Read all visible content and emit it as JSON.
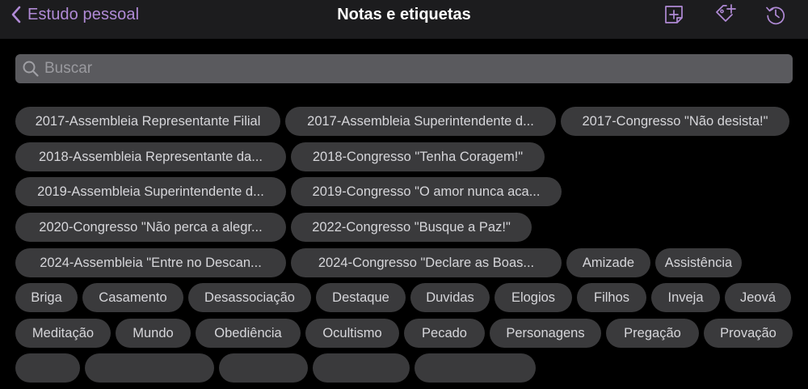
{
  "header": {
    "back_label": "Estudo pessoal",
    "title": "Notas e etiquetas",
    "actions": [
      "add-note-icon",
      "add-tag-icon",
      "history-icon"
    ],
    "accent_color": "#b08ad6"
  },
  "search": {
    "placeholder": "Buscar",
    "value": ""
  },
  "tags": [
    "2017-Assembleia Representante Filial",
    "2017-Assembleia Superintendente d...",
    "2017-Congresso \"Não desista!\"",
    "2018-Assembleia Representante da...",
    "2018-Congresso \"Tenha Coragem!\"",
    "2019-Assembleia Superintendente d...",
    "2019-Congresso \"O amor nunca aca...",
    "2020-Congresso \"Não perca a alegr...",
    "2022-Congresso \"Busque a Paz!\"",
    "2024-Assembleia \"Entre no Descan...",
    "2024-Congresso \"Declare as Boas...",
    "Amizade",
    "Assistência",
    "Briga",
    "Casamento",
    "Desassociação",
    "Destaque",
    "Duvidas",
    "Elogios",
    "Filhos",
    "Inveja",
    "Jeová",
    "Meditação",
    "Mundo",
    "Obediência",
    "Ocultismo",
    "Pecado",
    "Personagens",
    "Pregação",
    "Provação"
  ]
}
